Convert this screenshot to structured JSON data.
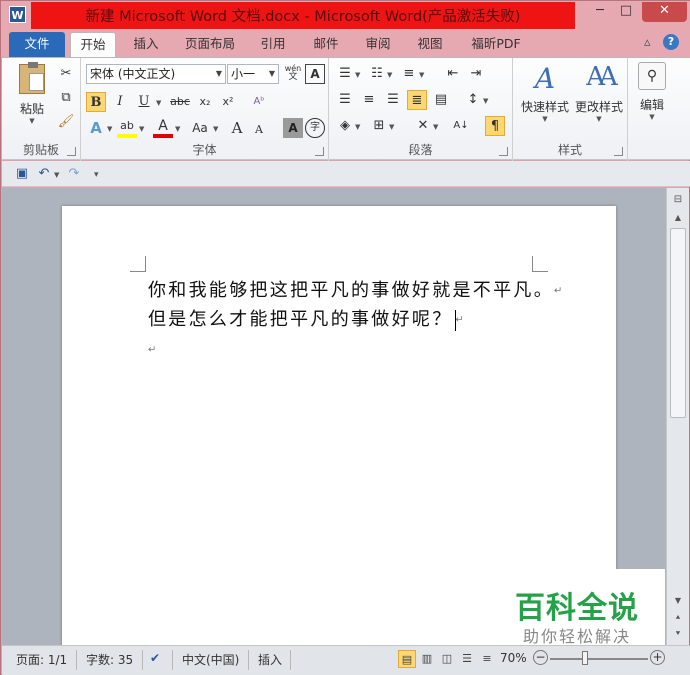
{
  "titlebar": {
    "app_icon": "W",
    "title": "新建 Microsoft Word 文档.docx - Microsoft Word(产品激活失败)",
    "minimize": "─",
    "maximize": "□",
    "close": "✕"
  },
  "tabs": [
    {
      "label": "文件"
    },
    {
      "label": "开始"
    },
    {
      "label": "插入"
    },
    {
      "label": "页面布局"
    },
    {
      "label": "引用"
    },
    {
      "label": "邮件"
    },
    {
      "label": "审阅"
    },
    {
      "label": "视图"
    },
    {
      "label": "福昕PDF"
    }
  ],
  "ribbon": {
    "clipboard": {
      "label": "剪贴板",
      "paste": "粘贴"
    },
    "font": {
      "label": "字体",
      "font_name": "宋体 (中文正文)",
      "font_size": "小一",
      "bold": "B",
      "italic": "I",
      "underline": "U",
      "strike": "abc",
      "sub": "x₂",
      "sup": "x²",
      "grow": "A",
      "shrink": "A",
      "case": "Aa",
      "phonetic": "wén",
      "border_char": "A",
      "char_shade": "A",
      "enclose": "字"
    },
    "paragraph": {
      "label": "段落"
    },
    "styles": {
      "label": "样式",
      "quick": "快速样式",
      "change": "更改样式"
    },
    "editing": {
      "label": "编辑"
    }
  },
  "document": {
    "line1": "你和我能够把这把平凡的事做好就是不平凡。",
    "line2": "但是怎么才能把平凡的事做好呢？",
    "para_mark": "↵"
  },
  "watermark": {
    "title": "百科全说",
    "subtitle": "助你轻松解决"
  },
  "status": {
    "page": "页面: 1/1",
    "words": "字数: 35",
    "language": "中文(中国)",
    "mode": "插入",
    "zoom": "70%",
    "zoom_out": "−",
    "zoom_in": "+"
  }
}
